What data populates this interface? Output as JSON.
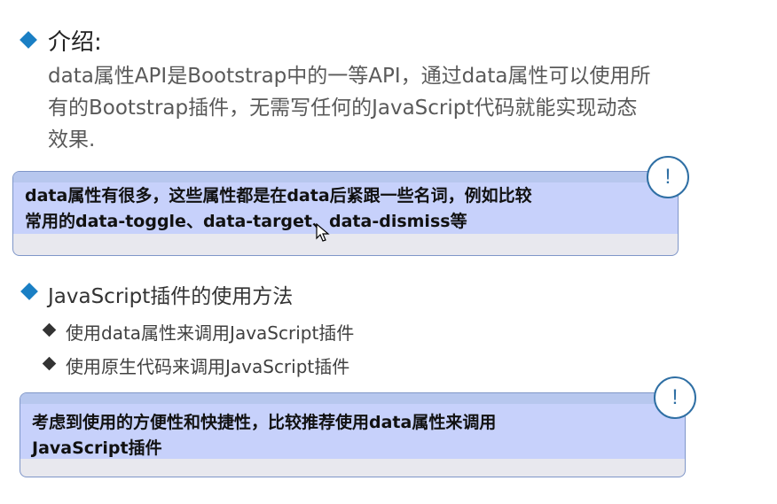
{
  "intro": {
    "heading": "介绍:",
    "paragraph_lines": [
      "data属性API是Bootstrap中的一等API，通过data属性可以使用所",
      "有的Bootstrap插件，无需写任何的JavaScript代码就能实现动态",
      "效果."
    ]
  },
  "note1": {
    "icon_text": "!",
    "lines": [
      "data属性有很多，这些属性都是在data后紧跟一些名词，例如比较",
      "常用的data-toggle、data-target、data-dismiss等"
    ]
  },
  "usage": {
    "heading": "JavaScript插件的使用方法",
    "items": [
      "使用data属性来调用JavaScript插件",
      "使用原生代码来调用JavaScript插件"
    ]
  },
  "note2": {
    "icon_text": "!",
    "lines": [
      "考虑到使用的方便性和快捷性，比较推荐使用data属性来调用",
      "JavaScript插件"
    ]
  },
  "colors": {
    "accent_blue": "#1a7fc4",
    "note_fill": "#c7d1fb",
    "note_border": "#7f96c8"
  }
}
